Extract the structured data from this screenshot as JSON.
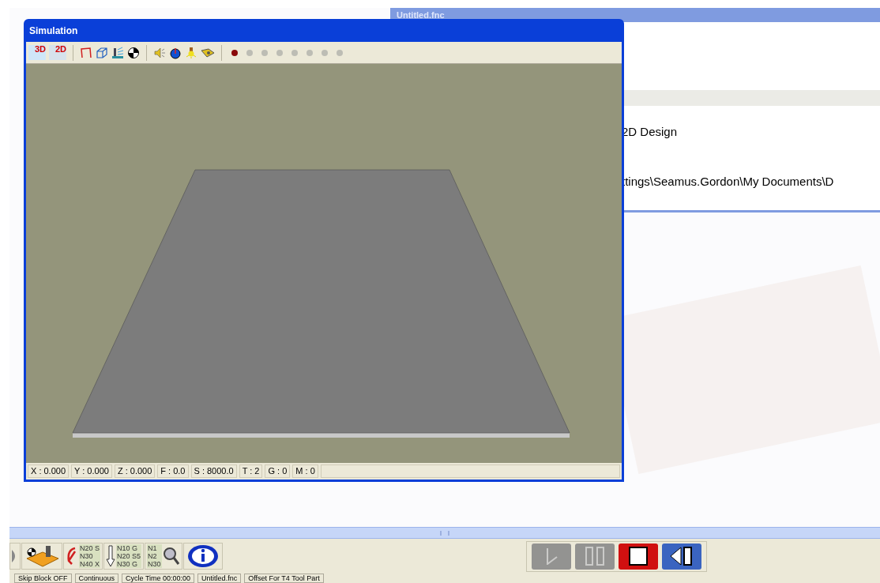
{
  "background_window": {
    "title": "Untitled.fnc",
    "rows": [
      {
        "text": "2D Design"
      },
      {
        "text": "ttings\\Seamus.Gordon\\My Documents\\D"
      }
    ]
  },
  "simulation": {
    "title": "Simulation",
    "toolbar": [
      {
        "kind": "view3d",
        "label": "3D"
      },
      {
        "kind": "view2d",
        "label": "2D"
      },
      {
        "kind": "sep"
      },
      {
        "kind": "outline"
      },
      {
        "kind": "wireframe"
      },
      {
        "kind": "coolant"
      },
      {
        "kind": "datum"
      },
      {
        "kind": "sep"
      },
      {
        "kind": "sound"
      },
      {
        "kind": "speed"
      },
      {
        "kind": "light"
      },
      {
        "kind": "tool"
      },
      {
        "kind": "sep"
      }
    ],
    "indicators": [
      {
        "on": true
      },
      {
        "on": false
      },
      {
        "on": false
      },
      {
        "on": false
      },
      {
        "on": false
      },
      {
        "on": false
      },
      {
        "on": false
      },
      {
        "on": false
      }
    ],
    "status": [
      "X : 0.000",
      "Y : 0.000",
      "Z : 0.000",
      "F : 0.0",
      "S : 8000.0",
      "T : 2",
      "G : 0",
      "M : 0"
    ]
  },
  "toolbar": [
    {
      "kind": "partial"
    },
    {
      "kind": "machine"
    },
    {
      "kind": "program",
      "lines": [
        "N20 S",
        "N30",
        "N40 X"
      ]
    },
    {
      "kind": "step",
      "lines": [
        "N10 G",
        "N20 S5",
        "N30 G"
      ]
    },
    {
      "kind": "search",
      "lines": [
        "N1",
        "N2",
        "N30"
      ]
    },
    {
      "kind": "info"
    }
  ],
  "playback": [
    {
      "kind": "play",
      "enabled": false
    },
    {
      "kind": "pause",
      "enabled": false
    },
    {
      "kind": "stop",
      "enabled": true
    },
    {
      "kind": "rewind",
      "enabled": true
    }
  ],
  "status_bar": [
    "Skip Block OFF",
    "Continuous",
    "Cycle Time 00:00:00",
    "Untitled.fnc",
    "Offset For T4 Tool Part"
  ]
}
